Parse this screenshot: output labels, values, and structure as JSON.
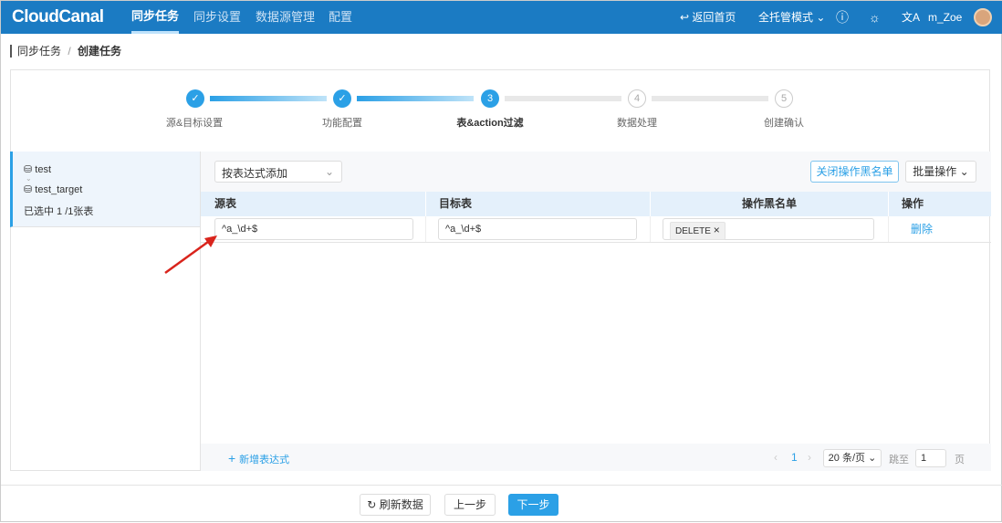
{
  "header": {
    "logo": "CloudCanal",
    "nav": [
      "同步任务",
      "同步设置",
      "数据源管理",
      "配置"
    ],
    "back_home": "返回首页",
    "mode": "全托管模式",
    "user": "m_Zoe"
  },
  "breadcrumb": {
    "parent": "同步任务",
    "sep": "/",
    "current": "创建任务"
  },
  "steps": [
    {
      "num": "✓",
      "label": "源&目标设置"
    },
    {
      "num": "✓",
      "label": "功能配置"
    },
    {
      "num": "3",
      "label": "表&action过滤"
    },
    {
      "num": "4",
      "label": "数据处理"
    },
    {
      "num": "5",
      "label": "创建确认"
    }
  ],
  "left": {
    "source_db": "test",
    "target_db": "test_target",
    "selected": "已选中 1 /1张表"
  },
  "toolbar": {
    "add_mode": "按表达式添加",
    "close_blacklist": "关闭操作黑名单",
    "batch": "批量操作"
  },
  "table": {
    "headers": [
      "源表",
      "目标表",
      "操作黑名单",
      "操作"
    ],
    "rows": [
      {
        "source": "^a_\\d+$",
        "target": "^a_\\d+$",
        "tag": "DELETE",
        "action": "删除"
      }
    ]
  },
  "footer": {
    "add_expr": "新增表达式",
    "page": "1",
    "page_size": "20 条/页",
    "jump": "跳至",
    "jump_val": "1",
    "page_unit": "页"
  },
  "bottom": {
    "refresh": "刷新数据",
    "prev": "上一步",
    "next": "下一步"
  }
}
